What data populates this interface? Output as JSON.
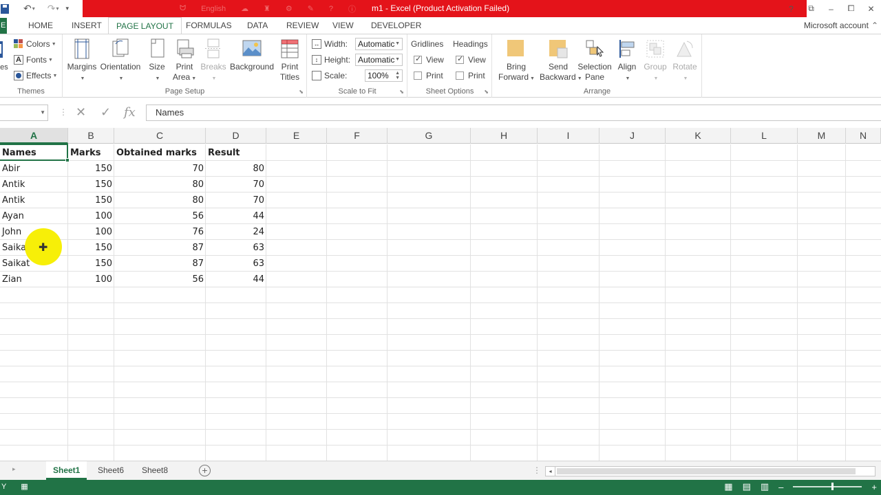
{
  "window": {
    "title": "m1 - Excel (Product Activation Failed)",
    "ghost_language": "English",
    "help": "?",
    "controls": [
      "⧉",
      "–",
      "⧠",
      "✕"
    ]
  },
  "tabs": {
    "file": "E",
    "items": [
      "HOME",
      "INSERT",
      "PAGE LAYOUT",
      "FORMULAS",
      "DATA",
      "REVIEW",
      "VIEW",
      "DEVELOPER"
    ],
    "active": "PAGE LAYOUT",
    "account": "Microsoft account"
  },
  "ribbon": {
    "themes": {
      "label": "Themes",
      "theme_partial": "nes",
      "colors": "Colors",
      "fonts": "Fonts",
      "effects": "Effects"
    },
    "page_setup": {
      "label": "Page Setup",
      "margins": "Margins",
      "orientation": "Orientation",
      "size": "Size",
      "print_area_1": "Print",
      "print_area_2": "Area",
      "breaks": "Breaks",
      "background": "Background",
      "print_titles_1": "Print",
      "print_titles_2": "Titles"
    },
    "scale_to_fit": {
      "label": "Scale to Fit",
      "width_label": "Width:",
      "width_value": "Automatic",
      "height_label": "Height:",
      "height_value": "Automatic",
      "scale_label": "Scale:",
      "scale_value": "100%"
    },
    "sheet_options": {
      "label": "Sheet Options",
      "gridlines": "Gridlines",
      "headings": "Headings",
      "view": "View",
      "print": "Print",
      "gridlines_view_checked": true,
      "gridlines_print_checked": false,
      "headings_view_checked": true,
      "headings_print_checked": false
    },
    "arrange": {
      "label": "Arrange",
      "bring_forward_1": "Bring",
      "bring_forward_2": "Forward",
      "send_backward_1": "Send",
      "send_backward_2": "Backward",
      "selection_pane_1": "Selection",
      "selection_pane_2": "Pane",
      "align": "Align",
      "group": "Group",
      "rotate": "Rotate"
    }
  },
  "formula_bar": {
    "name_box": "",
    "fx": "fx",
    "content": "Names"
  },
  "grid": {
    "columns": [
      "A",
      "B",
      "C",
      "D",
      "E",
      "F",
      "G",
      "H",
      "I",
      "J",
      "K",
      "L",
      "M",
      "N"
    ],
    "selected_column": "A",
    "headers": [
      "Names",
      "Marks",
      "Obtained marks",
      "Result"
    ],
    "rows": [
      [
        "Abir",
        "150",
        "70",
        "80"
      ],
      [
        "Antik",
        "150",
        "80",
        "70"
      ],
      [
        "Antik",
        "150",
        "80",
        "70"
      ],
      [
        "Ayan",
        "100",
        "56",
        "44"
      ],
      [
        "John",
        "100",
        "76",
        "24"
      ],
      [
        "Saikat",
        "150",
        "87",
        "63"
      ],
      [
        "Saikat",
        "150",
        "87",
        "63"
      ],
      [
        "Zian",
        "100",
        "56",
        "44"
      ]
    ]
  },
  "sheets": {
    "tabs": [
      "Sheet1",
      "Sheet6",
      "Sheet8"
    ],
    "active": "Sheet1",
    "add": "+"
  },
  "status": {
    "left": "Y"
  },
  "colors": {
    "excel_green": "#217346",
    "titlebar_red": "#e4131a",
    "cursor_highlight": "#f7ef08"
  }
}
